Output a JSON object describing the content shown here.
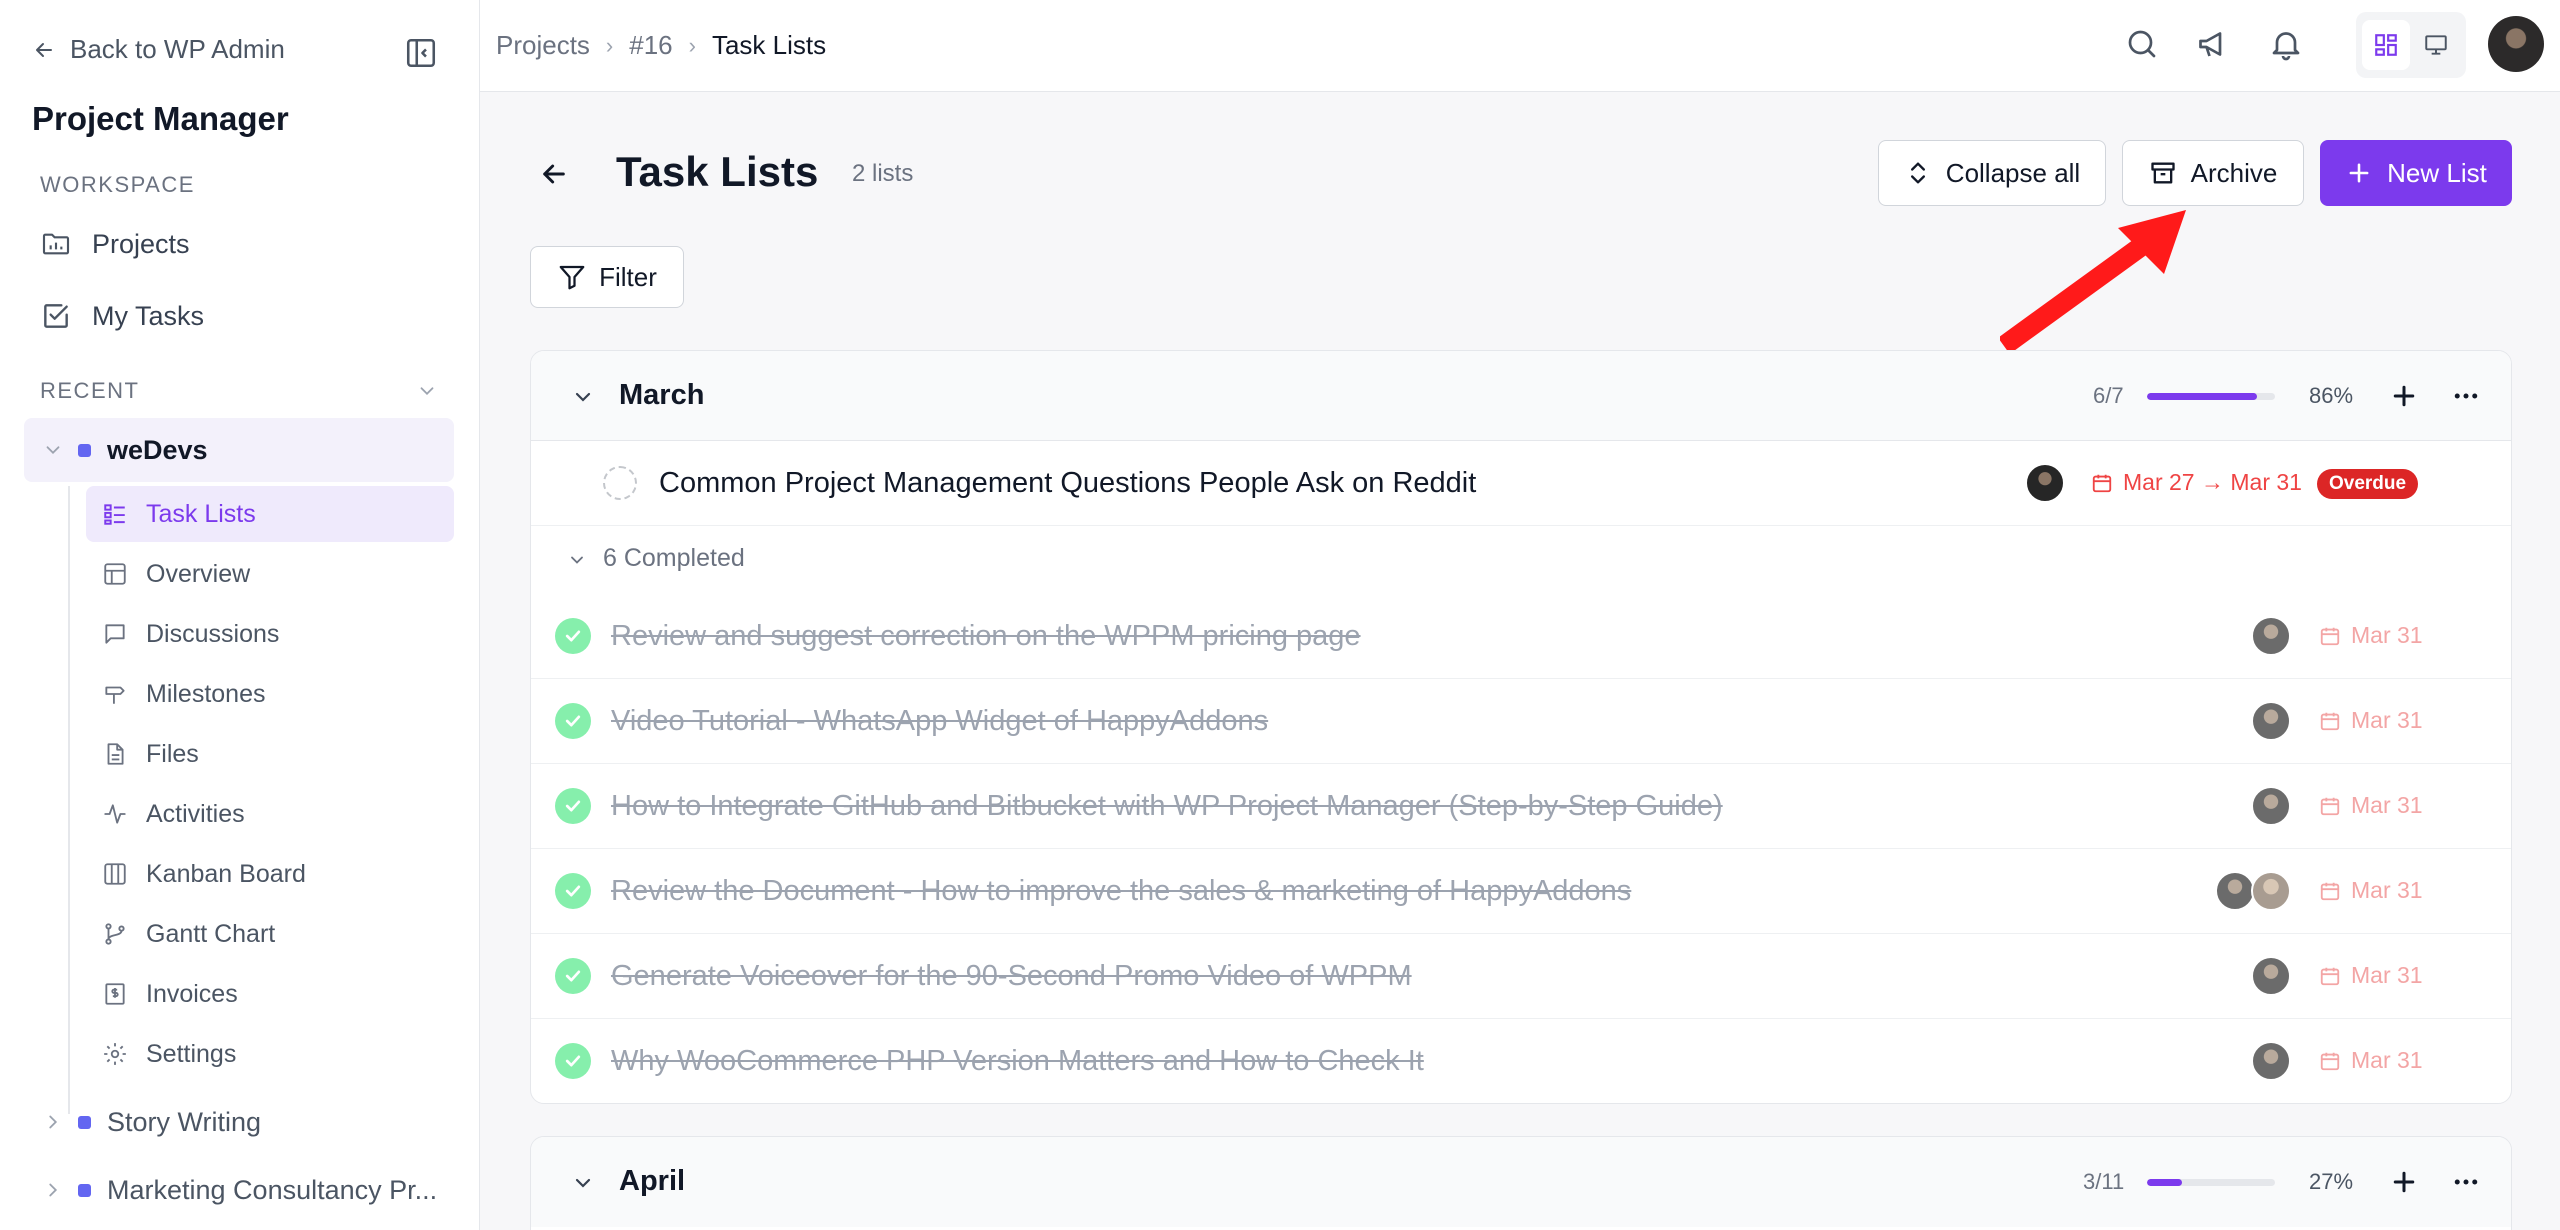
{
  "sidebar": {
    "back_label": "Back to WP Admin",
    "app_title": "Project Manager",
    "workspace_label": "WORKSPACE",
    "workspace_items": [
      {
        "label": "Projects"
      },
      {
        "label": "My Tasks"
      }
    ],
    "recent_label": "RECENT",
    "projects": [
      {
        "label": "weDevs",
        "expanded": true
      },
      {
        "label": "Story Writing",
        "expanded": false
      },
      {
        "label": "Marketing Consultancy Pr...",
        "expanded": false
      }
    ],
    "subnav": [
      {
        "label": "Task Lists",
        "active": true
      },
      {
        "label": "Overview"
      },
      {
        "label": "Discussions"
      },
      {
        "label": "Milestones"
      },
      {
        "label": "Files"
      },
      {
        "label": "Activities"
      },
      {
        "label": "Kanban Board"
      },
      {
        "label": "Gantt Chart"
      },
      {
        "label": "Invoices"
      },
      {
        "label": "Settings"
      }
    ],
    "accent": "#6366f1"
  },
  "breadcrumb": [
    "Projects",
    "#16",
    "Task Lists"
  ],
  "page": {
    "title": "Task Lists",
    "count": "2 lists",
    "collapse_label": "Collapse all",
    "archive_label": "Archive",
    "new_list_label": "New List",
    "filter_label": "Filter"
  },
  "lists": [
    {
      "name": "March",
      "progress_text": "6/7",
      "progress": 0.86,
      "percent": "86%",
      "open_tasks": [
        {
          "title": "Common Project Management Questions People Ask on Reddit",
          "due": "Mar 27 → Mar 31",
          "badge": "Overdue"
        }
      ],
      "completed_label": "6 Completed",
      "completed_tasks": [
        {
          "title": "Review and suggest correction on the WPPM pricing page",
          "due": "Mar 31"
        },
        {
          "title": "Video Tutorial - WhatsApp Widget of HappyAddons",
          "due": "Mar 31"
        },
        {
          "title": "How to Integrate GitHub and Bitbucket with WP Project Manager (Step-by-Step Guide)",
          "due": "Mar 31"
        },
        {
          "title": "Review the Document - How to improve the sales & marketing of HappyAddons",
          "due": "Mar 31"
        },
        {
          "title": "Generate Voiceover for the 90-Second Promo Video of WPPM",
          "due": "Mar 31"
        },
        {
          "title": "Why WooCommerce PHP Version Matters and How to Check It",
          "due": "Mar 31"
        }
      ]
    },
    {
      "name": "April",
      "progress_text": "3/11",
      "progress": 0.27,
      "percent": "27%"
    }
  ],
  "colors": {
    "primary": "#7c3aed",
    "overdue": "#dc2626",
    "annotation": "#ff0000"
  }
}
